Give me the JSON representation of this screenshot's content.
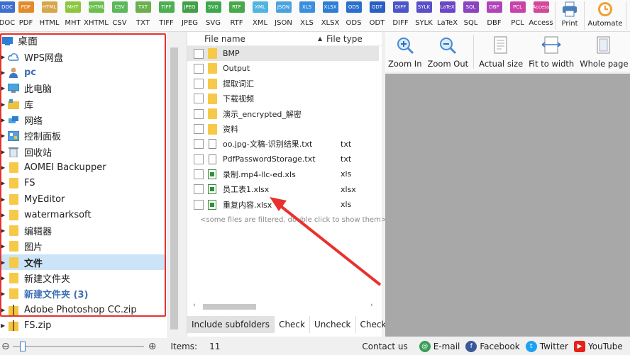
{
  "toolbar": {
    "formats": [
      {
        "label": "DOC",
        "color": "#3d6fd0"
      },
      {
        "label": "PDF",
        "color": "#e38a2a"
      },
      {
        "label": "HTML",
        "color": "#d7a64a"
      },
      {
        "label": "MHT",
        "color": "#8cc63f"
      },
      {
        "label": "XHTML",
        "color": "#6bbf4e"
      },
      {
        "label": "CSV",
        "color": "#5cb85c"
      },
      {
        "label": "TXT",
        "color": "#6ab04c"
      },
      {
        "label": "TIFF",
        "color": "#4caf50"
      },
      {
        "label": "JPEG",
        "color": "#43a047"
      },
      {
        "label": "SVG",
        "color": "#3ea84e"
      },
      {
        "label": "RTF",
        "color": "#49a84a"
      },
      {
        "label": "XML",
        "color": "#52b4e0"
      },
      {
        "label": "JSON",
        "color": "#4aa3df"
      },
      {
        "label": "XLS",
        "color": "#3b8ee0"
      },
      {
        "label": "XLSX",
        "color": "#2f7fd6"
      },
      {
        "label": "ODS",
        "color": "#2b6fcc"
      },
      {
        "label": "ODT",
        "color": "#2860c4"
      },
      {
        "label": "DIFF",
        "color": "#4b56c8"
      },
      {
        "label": "SYLK",
        "color": "#5a4fc8"
      },
      {
        "label": "LaTeX",
        "color": "#6a47c4"
      },
      {
        "label": "SQL",
        "color": "#8a44c0"
      },
      {
        "label": "DBF",
        "color": "#b044b8"
      },
      {
        "label": "PCL",
        "color": "#c843a8"
      },
      {
        "label": "Access",
        "color": "#d4479a"
      }
    ],
    "print_label": "Print",
    "automate_label": "Automate"
  },
  "tree": {
    "items": [
      {
        "label": "桌面",
        "icon": "desktop-icon",
        "style": "root"
      },
      {
        "label": "WPS网盘",
        "icon": "cloud-icon"
      },
      {
        "label": "pc",
        "icon": "user-icon",
        "style": "blue-bold"
      },
      {
        "label": "此电脑",
        "icon": "computer-icon"
      },
      {
        "label": "库",
        "icon": "library-icon"
      },
      {
        "label": "网络",
        "icon": "network-icon"
      },
      {
        "label": "控制面板",
        "icon": "control-panel-icon"
      },
      {
        "label": "回收站",
        "icon": "recycle-bin-icon"
      },
      {
        "label": "AOMEI Backupper",
        "icon": "folder-icon"
      },
      {
        "label": "FS",
        "icon": "folder-icon"
      },
      {
        "label": "MyEditor",
        "icon": "folder-icon"
      },
      {
        "label": "watermarksoft",
        "icon": "folder-icon"
      },
      {
        "label": "编辑器",
        "icon": "folder-icon"
      },
      {
        "label": "图片",
        "icon": "folder-icon"
      },
      {
        "label": "文件",
        "icon": "folder-icon",
        "style": "selected"
      },
      {
        "label": "新建文件夹",
        "icon": "folder-icon"
      },
      {
        "label": "新建文件夹 (3)",
        "icon": "folder-icon",
        "style": "blue-bold"
      },
      {
        "label": "Adobe Photoshop CC.zip",
        "icon": "zip-icon"
      },
      {
        "label": "FS.zip",
        "icon": "zip-icon"
      }
    ]
  },
  "file_list": {
    "col_name": "File name",
    "col_type": "File type",
    "rows": [
      {
        "name": "BMP",
        "type": "",
        "kind": "folder"
      },
      {
        "name": "Output",
        "type": "",
        "kind": "folder"
      },
      {
        "name": "提取词汇",
        "type": "",
        "kind": "folder"
      },
      {
        "name": "下载视频",
        "type": "",
        "kind": "folder"
      },
      {
        "name": "演示_encrypted_解密",
        "type": "",
        "kind": "folder"
      },
      {
        "name": "资料",
        "type": "",
        "kind": "folder"
      },
      {
        "name": "oo.jpg-文稿-识别结果.txt",
        "type": "txt",
        "kind": "txt"
      },
      {
        "name": "PdfPasswordStorage.txt",
        "type": "txt",
        "kind": "txt"
      },
      {
        "name": "录制.mp4-llc-ed.xls",
        "type": "xls",
        "kind": "xls"
      },
      {
        "name": "员工表1.xlsx",
        "type": "xlsx",
        "kind": "xls"
      },
      {
        "name": "重复内容.xlsx",
        "type": "xls",
        "kind": "xls"
      }
    ],
    "filtered_note": "<some files are filtered, double click to show them>",
    "include_subfolders": "Include subfolders",
    "check": "Check",
    "uncheck": "Uncheck",
    "check2": "Check"
  },
  "preview": {
    "zoom_in": "Zoom In",
    "zoom_out": "Zoom Out",
    "actual_size": "Actual size",
    "fit_width": "Fit to width",
    "whole_page": "Whole page"
  },
  "status": {
    "items_label": "Items:",
    "items_count": "11",
    "contact": "Contact us",
    "email": "E-mail",
    "facebook": "Facebook",
    "twitter": "Twitter",
    "youtube": "YouTube"
  }
}
